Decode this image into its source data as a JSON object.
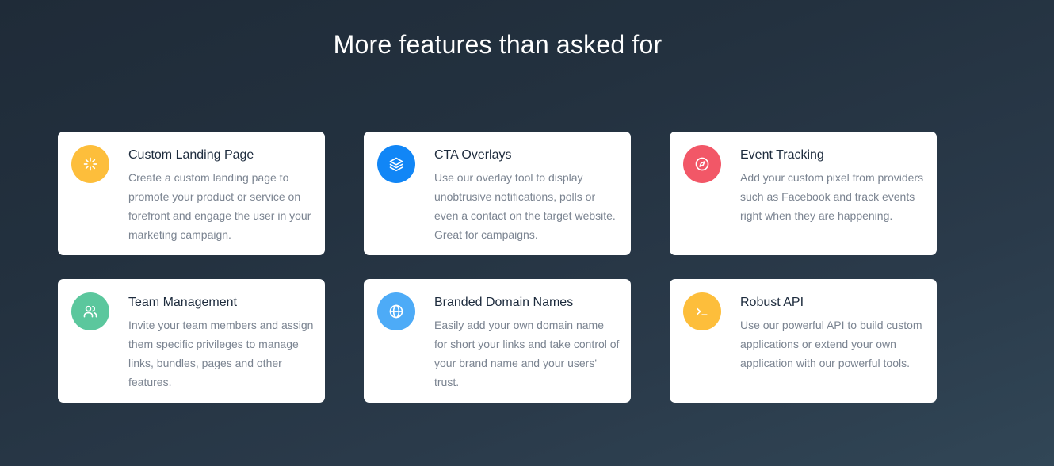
{
  "section": {
    "title": "More features than asked for"
  },
  "features": [
    {
      "title": "Custom Landing Page",
      "description": "Create a custom landing page to promote your product or service on forefront and engage the user in your marketing campaign.",
      "icon": "loader-icon",
      "color": "#fdbe3b"
    },
    {
      "title": "CTA Overlays",
      "description": "Use our overlay tool to display unobtrusive notifications, polls or even a contact on the target website. Great for campaigns.",
      "icon": "layers-icon",
      "color": "#1186f6"
    },
    {
      "title": "Event Tracking",
      "description": "Add your custom pixel from providers such as Facebook and track events right when they are happening.",
      "icon": "compass-icon",
      "color": "#f25767"
    },
    {
      "title": "Team Management",
      "description": "Invite your team members and assign them specific privileges to manage links, bundles, pages and other features.",
      "icon": "users-icon",
      "color": "#5bc79d"
    },
    {
      "title": "Branded Domain Names",
      "description": "Easily add your own domain name for short your links and take control of your brand name and your users' trust.",
      "icon": "globe-icon",
      "color": "#4dabf7"
    },
    {
      "title": "Robust API",
      "description": "Use our powerful API to build custom applications or extend your own application with our powerful tools.",
      "icon": "terminal-icon",
      "color": "#fdbe3b"
    }
  ]
}
